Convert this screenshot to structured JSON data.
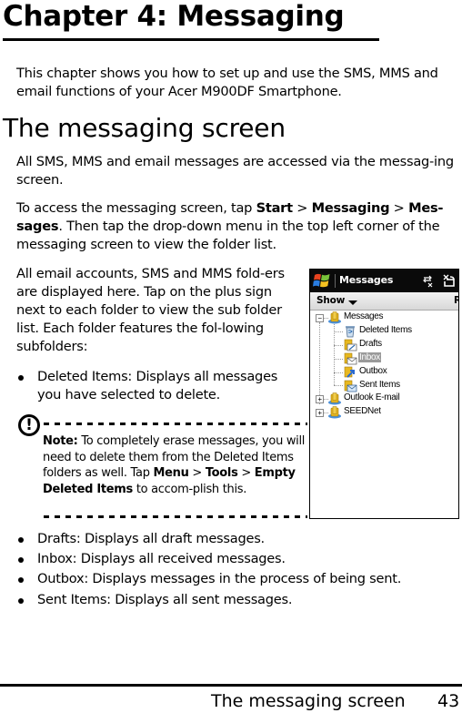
{
  "chapter": {
    "title": "Chapter 4: Messaging",
    "intro": "This chapter shows you how to set up and use the SMS, MMS and email functions of your Acer M900DF Smartphone."
  },
  "section": {
    "title": "The messaging screen",
    "para1": "All SMS, MMS and email messages are accessed via the messag-ing screen.",
    "para2": {
      "before": "To access the messaging screen, tap ",
      "start": "Start",
      "sep1": " > ",
      "messaging": "Messaging",
      "sep2": " > ",
      "messages": "Mes-sages",
      "after": ". Then tap the drop-down menu in the top left corner of the messaging screen to view the folder list."
    },
    "para3": "All email accounts, SMS and MMS fold-ers are displayed here. Tap on the plus sign next to each folder to view the sub folder list. Each folder features the fol-lowing subfolders:",
    "bullets_a": [
      "Deleted Items: Displays all messages you have selected to delete."
    ],
    "note": {
      "label": "Note:",
      "text1": " To completely erase messages, you will need to delete them from the Deleted Items folders as well. Tap ",
      "menu": "Menu",
      "sep1": " > ",
      "tools": "Tools",
      "sep2": " > ",
      "empty": "Empty Deleted Items",
      "text2": " to accom-plish this.",
      "icon": "exclamation-circle-icon",
      "icon_glyph": "!"
    },
    "bullets_b": [
      "Drafts: Displays all draft messages.",
      "Inbox: Displays all received messages.",
      "Outbox: Displays messages in the process of being sent.",
      "Sent Items: Displays all sent messages."
    ]
  },
  "screenshot": {
    "title": "Messages",
    "toolbar": {
      "show_label": "Show",
      "right_label_truncated": "R"
    },
    "tree": [
      {
        "label": "Messages",
        "level": 0,
        "expander": "−",
        "icon": "account-folder-icon"
      },
      {
        "label": "Deleted Items",
        "level": 1,
        "icon": "trash-folder-icon"
      },
      {
        "label": "Drafts",
        "level": 1,
        "icon": "drafts-folder-icon"
      },
      {
        "label": "Inbox",
        "level": 1,
        "icon": "inbox-folder-icon",
        "selected": true
      },
      {
        "label": "Outbox",
        "level": 1,
        "icon": "outbox-folder-icon"
      },
      {
        "label": "Sent Items",
        "level": 1,
        "icon": "sent-folder-icon"
      },
      {
        "label": "Outlook E-mail",
        "level": 0,
        "expander": "+",
        "icon": "account-folder-icon"
      },
      {
        "label": "SEEDNet",
        "level": 0,
        "expander": "+",
        "icon": "account-folder-icon"
      }
    ],
    "colors": {
      "titlebar": "#0a0a0a",
      "selection": "#9a9a9a",
      "folder": "#e8b820"
    }
  },
  "footer": {
    "section": "The messaging screen",
    "page": "43"
  }
}
